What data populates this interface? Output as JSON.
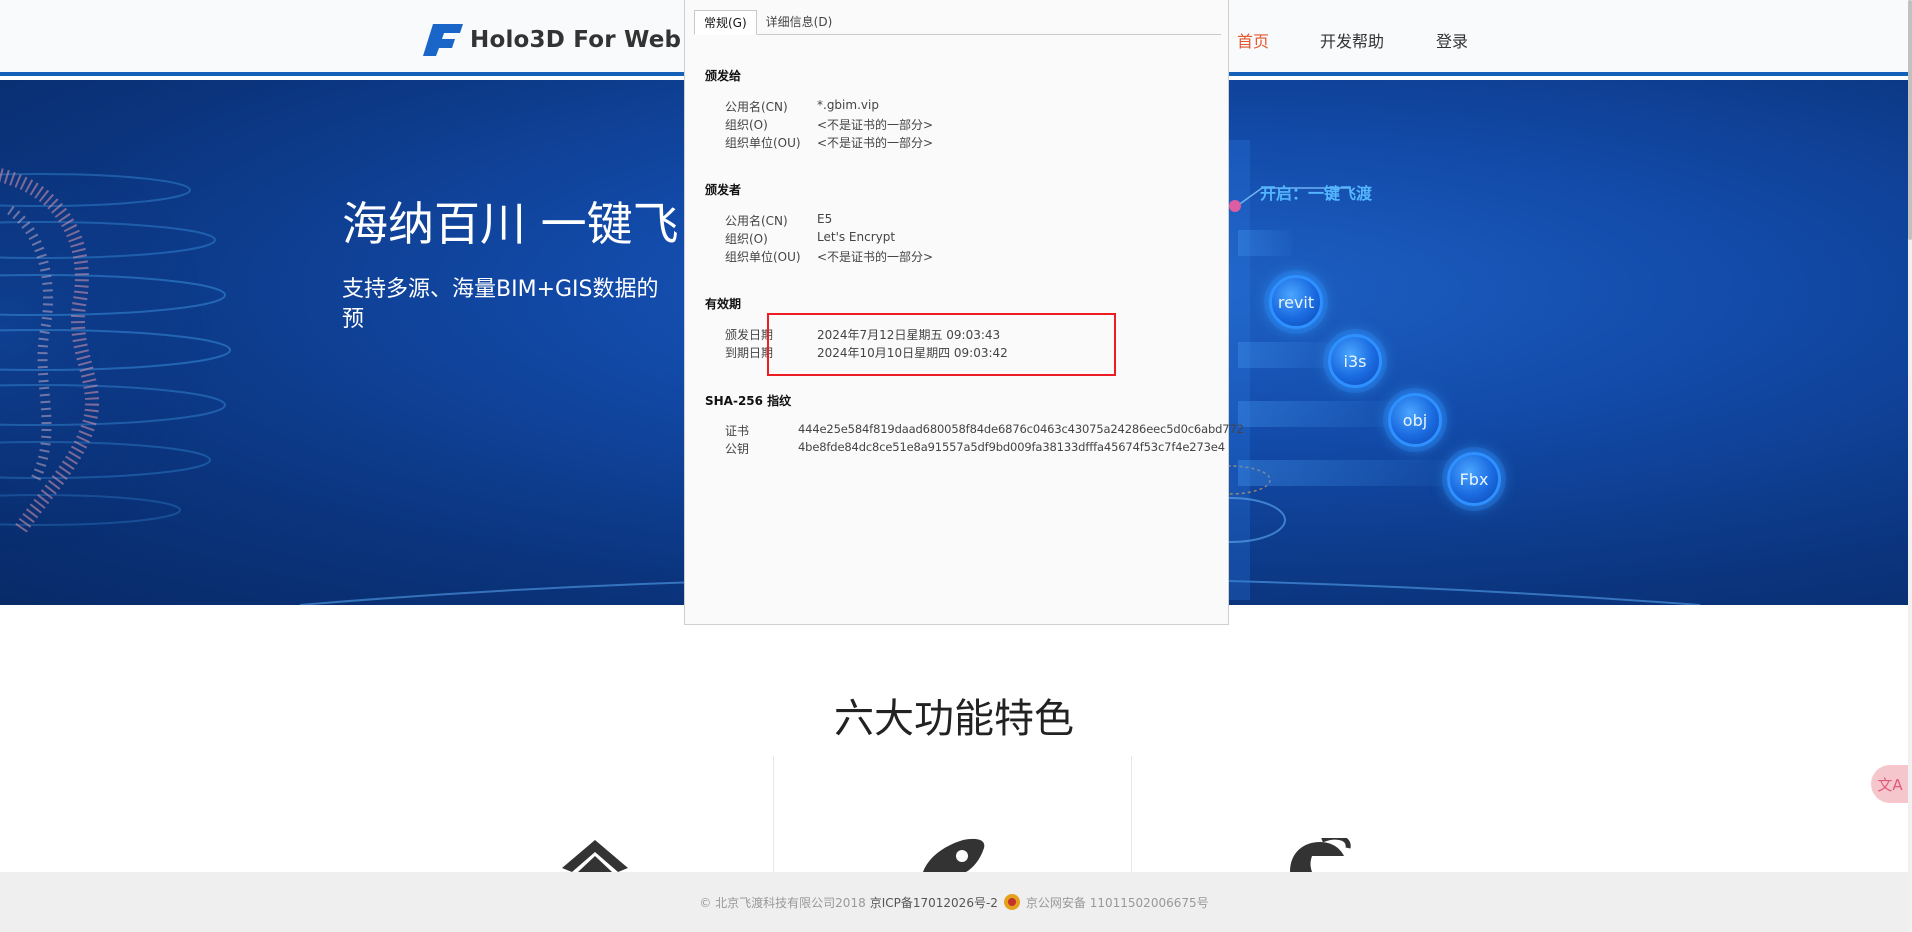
{
  "header": {
    "logo_text": "Holo3D For Web",
    "nav": [
      {
        "label": "首页",
        "active": true
      },
      {
        "label": "开发帮助",
        "active": false
      },
      {
        "label": "登录",
        "active": false
      }
    ]
  },
  "hero": {
    "title": "海纳百川 一键飞",
    "subtitle": "支持多源、海量BIM+GIS数据的",
    "subtitle_line2": "预",
    "kicker": "开启：一键飞渡",
    "formats": [
      "revit",
      "i3s",
      "obj",
      "Fbx"
    ]
  },
  "certificate": {
    "tabs": [
      "常规(G)",
      "详细信息(D)"
    ],
    "issued_to": {
      "heading": "颁发给",
      "rows": [
        {
          "label": "公用名(CN)",
          "value": "*.gbim.vip"
        },
        {
          "label": "组织(O)",
          "value": "<不是证书的一部分>"
        },
        {
          "label": "组织单位(OU)",
          "value": "<不是证书的一部分>"
        }
      ]
    },
    "issued_by": {
      "heading": "颁发者",
      "rows": [
        {
          "label": "公用名(CN)",
          "value": "E5"
        },
        {
          "label": "组织(O)",
          "value": "Let's Encrypt"
        },
        {
          "label": "组织单位(OU)",
          "value": "<不是证书的一部分>"
        }
      ]
    },
    "validity": {
      "heading": "有效期",
      "rows": [
        {
          "label": "颁发日期",
          "value": "2024年7月12日星期五 09:03:43"
        },
        {
          "label": "到期日期",
          "value": "2024年10月10日星期四 09:03:42"
        }
      ]
    },
    "fingerprints": {
      "heading": "SHA-256 指纹",
      "rows": [
        {
          "label": "证书",
          "value": "444e25e584f819daad680058f84de6876c0463c43075a24286eec5d0c6abd772"
        },
        {
          "label": "公钥",
          "value": "4be8fde84dc8ce51e8a91557a5df9bd009fa38133dfffa45674f53c7f4e273e4"
        }
      ]
    }
  },
  "features": {
    "title": "六大功能特色"
  },
  "footer": {
    "copyright": "© 北京飞渡科技有限公司2018",
    "icp": "京ICP备17012026号-2",
    "police": "京公网安备 11011502006675号"
  },
  "colors": {
    "accent_nav": "#e4572e",
    "header_border": "#1560b8",
    "highlight_box": "#ee1c23"
  }
}
